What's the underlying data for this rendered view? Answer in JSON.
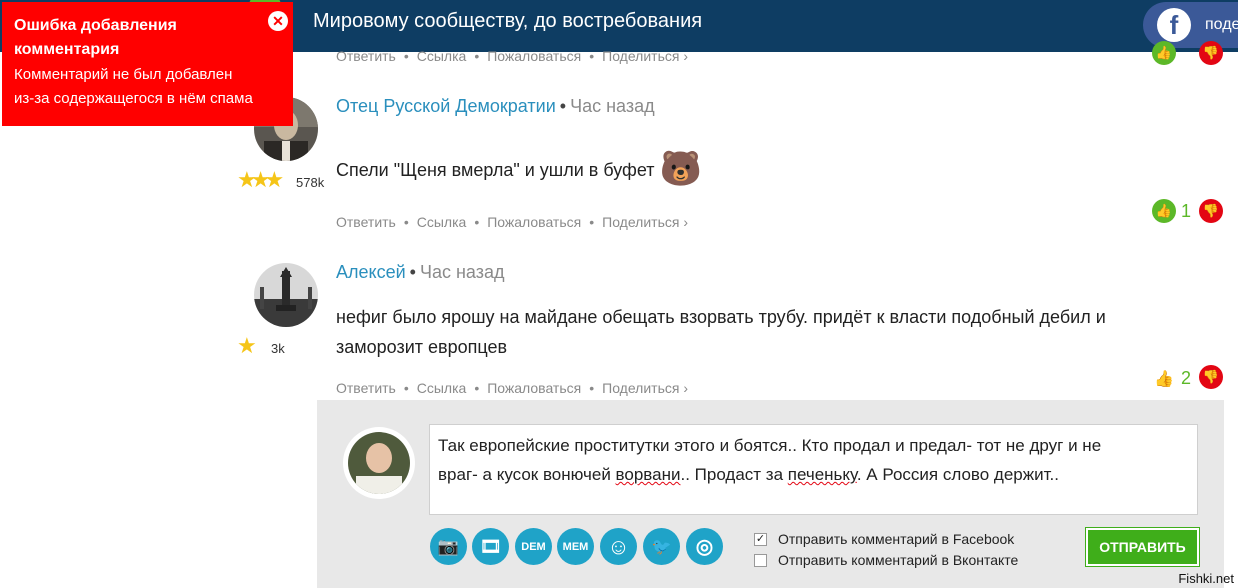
{
  "header": {
    "title": "Мировому сообществу, до востребования",
    "share_label": "поде",
    "share_icon": "f"
  },
  "error": {
    "title": "Ошибка добавления комментария",
    "message_line1": "Комментарий не был добавлен",
    "message_line2": "из-за содержащегося в нём спама",
    "close_icon": "✕"
  },
  "actions": {
    "reply": "Ответить",
    "link": "Ссылка",
    "report": "Пожаловаться",
    "share": "Поделиться ›",
    "sep": "•"
  },
  "comments": [
    {
      "author": "Отец Русской Демократии",
      "time": "Час назад",
      "text": "Спели \"Щеня вмерла\" и ушли в буфет",
      "rating": "578k",
      "stars": "★★★",
      "votes": "1",
      "emoji": "🐻"
    },
    {
      "author": "Алексей",
      "time": "Час назад",
      "text_line1": "нефиг было ярошу на майдане обещать взорвать трубу. придёт к власти подобный дебил и",
      "text_line2": "заморозит европцев",
      "rating": "3k",
      "stars": "★",
      "votes": "2"
    }
  ],
  "reply": {
    "line1": "Так европейские проститутки этого и боятся.. Кто продал и предал- тот не друг и не",
    "line2_a": "враг- а кусок вонючей ",
    "line2_b": "ворвани",
    "line2_c": ".. Продаст за ",
    "line2_d": "печеньку",
    "line2_e": ". А Россия слово держит..",
    "tools": [
      "📷",
      "🎞",
      "DEM",
      "MEM",
      "☺",
      "🐦",
      "◎"
    ],
    "fb_checkbox_label": "Отправить комментарий в Facebook",
    "vk_checkbox_label": "Отправить комментарий в Вконтакте",
    "fb_checked": "✓",
    "submit_label": "ОТПРАВИТЬ"
  },
  "watermark": "Fishki.net",
  "colors": {
    "header_bg": "#0e3d63",
    "error_bg": "#ff0000",
    "link": "#2a8fbd",
    "vote_up": "#5cb828",
    "vote_down": "#e30613",
    "submit_bg": "#3fae1a",
    "tool_bg": "#1fa3c8"
  }
}
